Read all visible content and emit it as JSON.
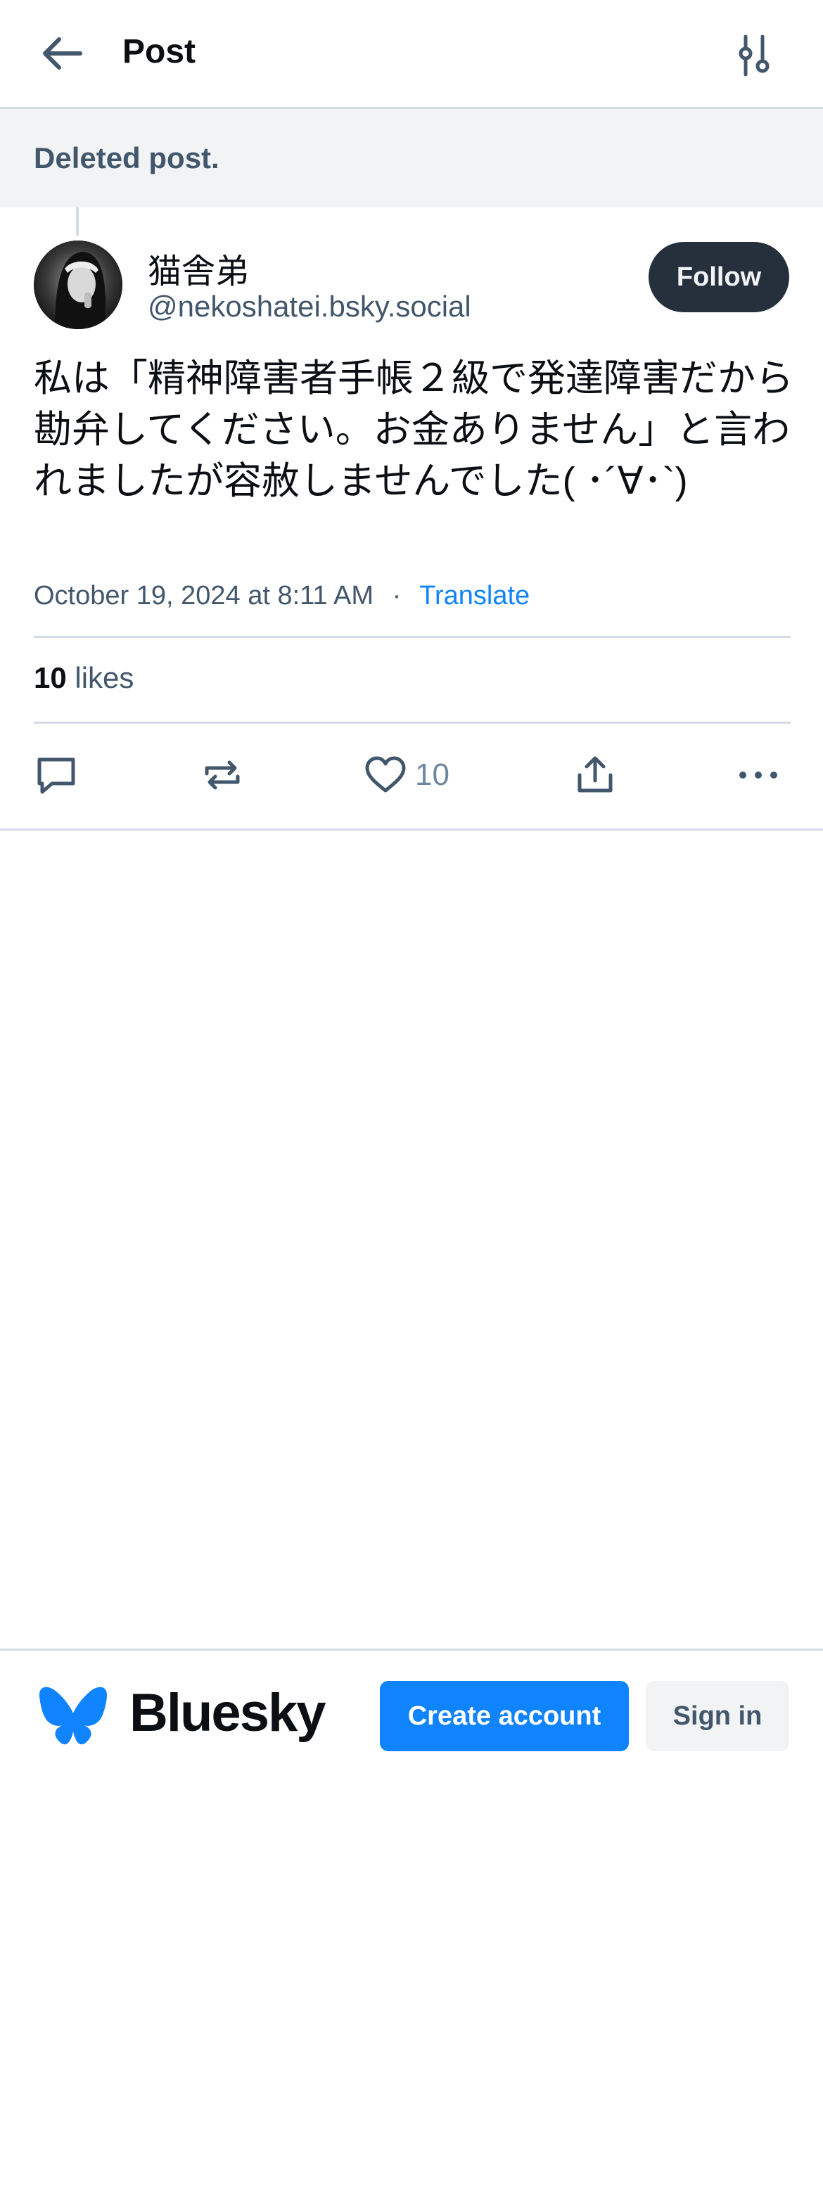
{
  "header": {
    "title": "Post",
    "back_icon": "arrow-left-icon",
    "settings_icon": "sliders-icon"
  },
  "parent": {
    "deleted_text": "Deleted post."
  },
  "post": {
    "author_name": "猫舎弟",
    "author_handle": "@nekoshatei.bsky.social",
    "follow_label": "Follow",
    "text": "私は「精神障害者手帳２級で発達障害だから勘弁してください。お金ありません」と言われましたが容赦しませんでした( ･´∀･`)",
    "timestamp": "October 19, 2024 at 8:11 AM",
    "separator": "·",
    "translate_label": "Translate",
    "likes_count": "10",
    "likes_label": "likes",
    "like_button_count": "10"
  },
  "actions": {
    "reply_icon": "speech-bubble-icon",
    "repost_icon": "repost-icon",
    "like_icon": "heart-icon",
    "share_icon": "share-icon",
    "more_icon": "ellipsis-icon"
  },
  "footer": {
    "brand": "Bluesky",
    "create_account_label": "Create account",
    "sign_in_label": "Sign in"
  },
  "colors": {
    "accent": "#1083fe",
    "follow_bg": "#25303c",
    "text_secondary": "#42576c",
    "border": "#d4dbe2",
    "deleted_bg": "#f1f3f5"
  }
}
